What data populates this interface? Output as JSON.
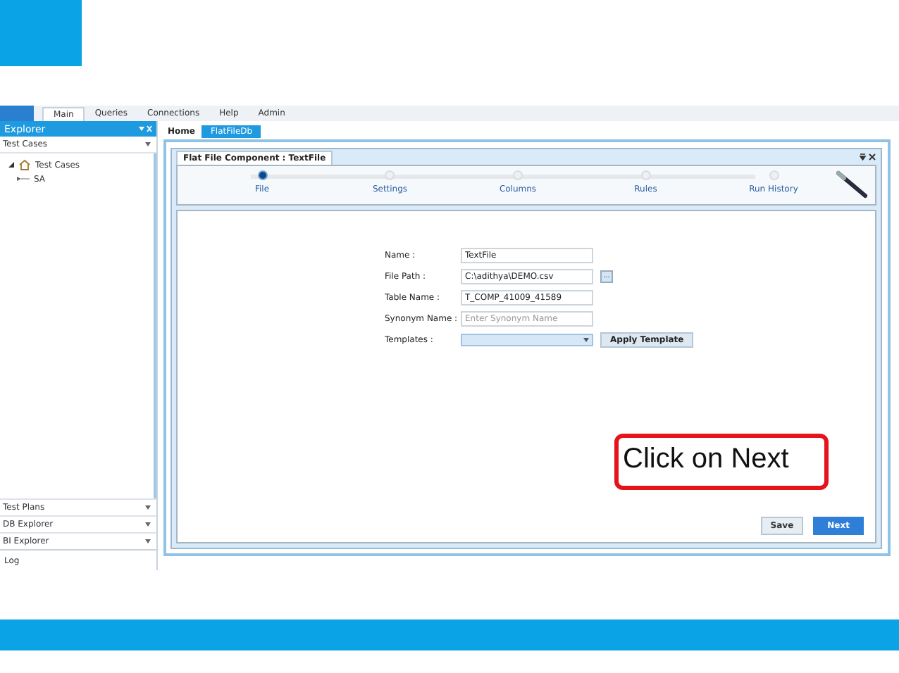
{
  "menu": [
    {
      "label": "Main",
      "selected": true
    },
    {
      "label": "Queries",
      "selected": false
    },
    {
      "label": "Connections",
      "selected": false
    },
    {
      "label": "Help",
      "selected": false
    },
    {
      "label": "Admin",
      "selected": false
    }
  ],
  "explorer": {
    "title": "Explorer",
    "section": "Test Cases",
    "tree": [
      {
        "label": "Test Cases",
        "expanded": true,
        "children": [
          {
            "label": "SA"
          }
        ]
      }
    ],
    "panels": [
      "Test Plans",
      "DB Explorer",
      "BI Explorer"
    ],
    "bottom_tab": "Log"
  },
  "doc_tabs": [
    {
      "label": "Home",
      "selected": false
    },
    {
      "label": "FlatFileDb",
      "selected": true
    }
  ],
  "window": {
    "title": "Flat File Component : TextFile"
  },
  "steps": [
    {
      "label": "File",
      "selected": true
    },
    {
      "label": "Settings",
      "selected": false
    },
    {
      "label": "Columns",
      "selected": false
    },
    {
      "label": "Rules",
      "selected": false
    },
    {
      "label": "Run History",
      "selected": false
    }
  ],
  "form": [
    {
      "kind": "text",
      "label": "Name :",
      "value": "TextFile"
    },
    {
      "kind": "path",
      "label": "File Path :",
      "value": "C:\\adithya\\DEMO.csv",
      "button": "..."
    },
    {
      "kind": "text",
      "label": "Table Name :",
      "value": "T_COMP_41009_41589"
    },
    {
      "kind": "text",
      "label": "Synonym Name :",
      "placeholder": "Enter Synonym Name"
    },
    {
      "kind": "dropdown",
      "label": "Templates :",
      "button": "Apply Template"
    }
  ],
  "callout": "Click on Next",
  "buttons": [
    {
      "label": "Save",
      "primary": false
    },
    {
      "label": "Next",
      "primary": true
    }
  ]
}
